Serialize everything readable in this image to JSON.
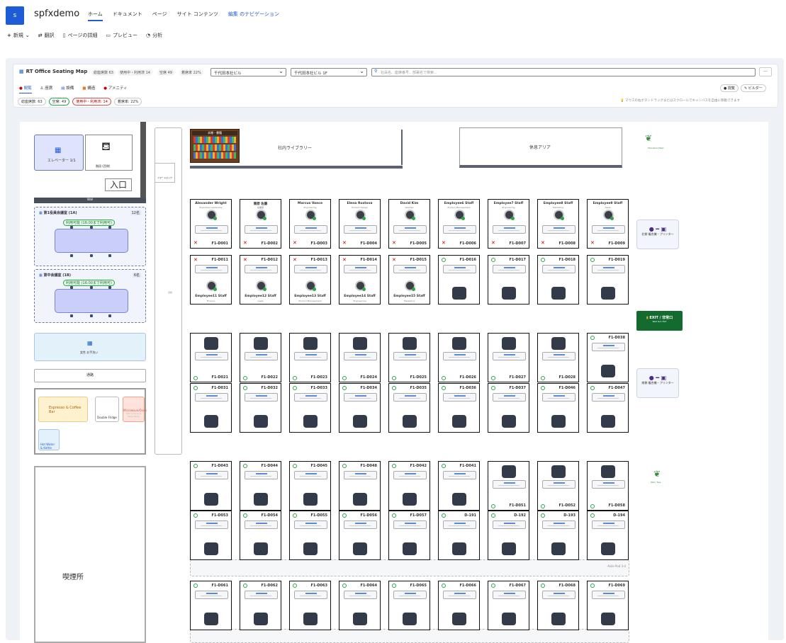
{
  "site": {
    "logo": "s",
    "name": "spfxdemo",
    "nav": [
      "ホーム",
      "ドキュメント",
      "ページ",
      "サイト コンテンツ",
      "編集 のナビゲーション"
    ]
  },
  "cmd": [
    "新規",
    "翻訳",
    "ページの詳細",
    "プレビュー",
    "分析"
  ],
  "app": {
    "title": "RT Office Seating Map",
    "stats": [
      "総座席数 63",
      "使用中・利用済 14",
      "空席 49",
      "着席率 22%"
    ],
    "building": "千代田本社ビル",
    "floor": "千代田本社ビル 1F",
    "search_placeholder": "社員名、座席番号、部署名で検索...",
    "more": "...",
    "tabs": [
      "閲覧",
      "座席",
      "設備",
      "構造",
      "アメニティ"
    ],
    "modes": [
      "閲覧",
      "ビルダー"
    ],
    "chips": [
      "総座席数: 63",
      "空席: 49",
      "使用中・利用済: 14",
      "着席率: 22%"
    ],
    "hint": "マウスの右ボタンドラッグまたはスクロールでキャンバスを自由に移動できます"
  },
  "plan": {
    "elevator": "エレベーター 1/1",
    "stairs": "階段 (西側)",
    "entrance": "入口",
    "wall": "Wall",
    "smartlock": "スマートロック",
    "library": "社内ライブラリー",
    "library_shelf": "本棚・書籍",
    "rest": "休息アリア",
    "meet1": {
      "name": "第1役員会議室 (1A)",
      "cap": "12名",
      "status": "利用可能 (16:00まで利用可)"
    },
    "meet2": {
      "name": "第中会議室 (1B)",
      "cap": "6名",
      "status": "利用可能 (16:00まで利用可)"
    },
    "wash": "女性 お手洗い",
    "hall": "通路",
    "coffee": "Espresso & Coffee Bar",
    "fridge": "Double Fridge",
    "microwave": "Microwave/Oven",
    "microwave_sub": "Ship & Rang & Make Pasta",
    "kettle": "Hot Water & Kettle",
    "smoking": "喫煙所",
    "plant1": "Monstera Plant",
    "plant2": "Palm Tree",
    "printer1": "北側 複合機・プリンター",
    "printer2": "南側 複合機・プリンター",
    "exit": "EXIT / 非常口",
    "exit_sub": "Real Run Exit",
    "aisle": "Aisle Pod 3-4",
    "corridor": "通路",
    "row1": [
      [
        "Alexander Wright",
        "Executive Leadership",
        "F1-D001"
      ],
      [
        "栗原 佐藤",
        "営業部",
        "F1-D002"
      ],
      [
        "Marcus Vance",
        "Engineering",
        "F1-D003"
      ],
      [
        "Elena Rostova",
        "Product Design",
        "F1-D004"
      ],
      [
        "David Kim",
        "DevOps",
        "F1-D005"
      ],
      [
        "Employee6 Staff",
        "Product Management",
        "F1-D006"
      ],
      [
        "Employee7 Staff",
        "Engineering",
        "F1-D007"
      ],
      [
        "Employee8 Staff",
        "Marketing",
        "F1-D008"
      ],
      [
        "Employee9 Staff",
        "Sales",
        "F1-D009"
      ]
    ],
    "row2": [
      [
        "F1-D011",
        "Employee11 Staff",
        "Finance"
      ],
      [
        "F1-D012",
        "Employee12 Staff",
        "Legal"
      ],
      [
        "F1-D013",
        "Employee13 Staff",
        "Product Management"
      ],
      [
        "F1-D014",
        "Employee14 Staff",
        "Engineering"
      ],
      [
        "F1-D015",
        "Employee15 Staff",
        "Marketing"
      ],
      [
        "F1-D016",
        "",
        ""
      ],
      [
        "F1-D017",
        "",
        ""
      ],
      [
        "F1-D018",
        "",
        ""
      ],
      [
        "F1-D019",
        "",
        ""
      ]
    ],
    "row3": [
      "F1-D021",
      "F1-D022",
      "F1-D023",
      "F1-D024",
      "F1-D025",
      "F1-D026",
      "F1-D027",
      "F1-D028",
      "F1-D038"
    ],
    "row4": [
      "F1-D031",
      "F1-D032",
      "F1-D033",
      "F1-D034",
      "F1-D035",
      "F1-D036",
      "F1-D037",
      "F1-D046",
      "F1-D047"
    ],
    "row5": [
      "F1-D043",
      "F1-D044",
      "F1-D045",
      "F1-D048",
      "F1-D042",
      "F1-D041",
      "F1-D051",
      "F1-D052",
      "F1-D058"
    ],
    "row6": [
      "F1-D053",
      "F1-D054",
      "F1-D055",
      "F1-D056",
      "F1-D057",
      "D-191",
      "D-192",
      "D-193",
      "D-194"
    ],
    "row7": [
      "F1-D061",
      "F1-D062",
      "F1-D063",
      "F1-D064",
      "F1-D065",
      "F1-D066",
      "F1-D067",
      "F1-D068",
      "F1-D069"
    ]
  }
}
